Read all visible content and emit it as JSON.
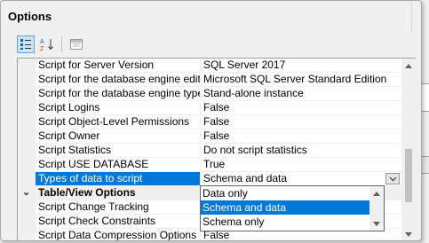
{
  "panel": {
    "title": "Options"
  },
  "toolbar": {
    "categorized_icon": "categorized-icon",
    "alphabetical_icon": "alphabetical-icon",
    "property_pages_icon": "property-pages-icon"
  },
  "properties": [
    {
      "name": "Script for Server Version",
      "value": "SQL Server 2017"
    },
    {
      "name": "Script for the database engine edition",
      "value": "Microsoft SQL Server Standard Edition"
    },
    {
      "name": "Script for the database engine type",
      "value": "Stand-alone instance"
    },
    {
      "name": "Script Logins",
      "value": "False"
    },
    {
      "name": "Script Object-Level Permissions",
      "value": "False"
    },
    {
      "name": "Script Owner",
      "value": "False"
    },
    {
      "name": "Script Statistics",
      "value": "Do not script statistics"
    },
    {
      "name": "Script USE DATABASE",
      "value": "True"
    },
    {
      "name": "Types of data to script",
      "value": "Schema and data"
    }
  ],
  "category": {
    "label": "Table/View Options",
    "toggle": "⌄"
  },
  "table_view_properties": [
    {
      "name": "Script Change Tracking",
      "value": ""
    },
    {
      "name": "Script Check Constraints",
      "value": ""
    },
    {
      "name": "Script Data Compression Options",
      "value": "False"
    }
  ],
  "dropdown": {
    "options": [
      "Data only",
      "Schema and data",
      "Schema only"
    ],
    "selected": "Schema and data"
  },
  "background": {
    "partial_text": "ar"
  },
  "colors": {
    "selection": "#0078d7",
    "window_bg": "#f0f0f0"
  }
}
